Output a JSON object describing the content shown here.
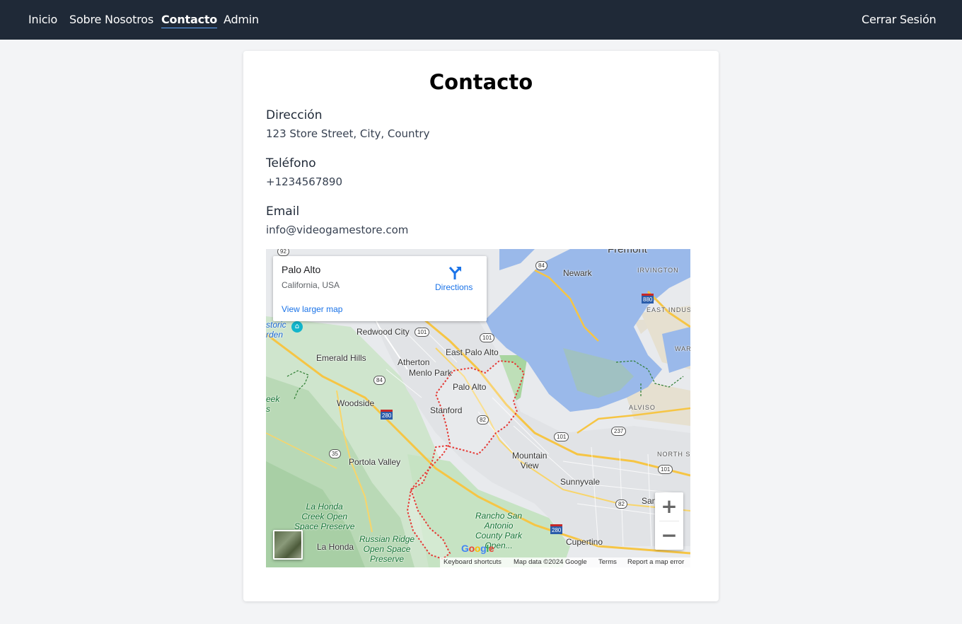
{
  "nav": {
    "links": [
      "Inicio",
      "Sobre Nosotros",
      "Contacto",
      "Admin"
    ],
    "logout": "Cerrar Sesión",
    "active": "Contacto"
  },
  "contact": {
    "title": "Contacto",
    "address_label": "Dirección",
    "address": "123 Store Street, City, Country",
    "phone_label": "Teléfono",
    "phone": "+1234567890",
    "email_label": "Email",
    "email": "info@videogamestore.com"
  },
  "map": {
    "info": {
      "place": "Palo Alto",
      "region": "California, USA",
      "directions": "Directions",
      "larger_map": "View larger map"
    },
    "labels": {
      "fremont": "Fremont",
      "newark": "Newark",
      "irvington": "IRVINGTON",
      "east_indust": "EAST INDUST",
      "historic_garden": "storic\nrden",
      "redwood_city": "Redwood City",
      "east_palo_alto": "East Palo Alto",
      "emerald_hills": "Emerald Hills",
      "atherton": "Atherton",
      "menlo_park": "Menlo Park",
      "palo_alto": "Palo Alto",
      "woodside": "Woodside",
      "stanford": "Stanford",
      "eek": "eek\ns",
      "war": "WAR",
      "alviso": "ALVISO",
      "mountain_view": "Mountain\nView",
      "north_s": "NORTH S",
      "portola_valley": "Portola Valley",
      "sunnyvale": "Sunnyvale",
      "san": "San",
      "la_honda_creek": "La Honda\nCreek Open\nSpace Preserve",
      "rancho_san_antonio": "Rancho San\nAntonio\nCounty Park\nOpen...",
      "russian_ridge": "Russian Ridge\nOpen Space\nPreserve",
      "la_honda": "La Honda",
      "cupertino": "Cupertino"
    },
    "shields": {
      "r92": "92",
      "r84a": "84",
      "r880": "880",
      "r101a": "101",
      "r101b": "101",
      "r84b": "84",
      "r280a": "280",
      "r82a": "82",
      "r237": "237",
      "r101c": "101",
      "r35": "35",
      "r101d": "101",
      "r82b": "82",
      "r280b": "280"
    },
    "zoom_in": "+",
    "zoom_out": "−",
    "google": [
      "G",
      "o",
      "o",
      "g",
      "l",
      "e"
    ],
    "attribution": {
      "shortcuts": "Keyboard shortcuts",
      "data": "Map data ©2024 Google",
      "terms": "Terms",
      "report": "Report a map error"
    }
  },
  "colors": {
    "nav_bg": "#1f2937",
    "page_bg": "#f3f4f6",
    "water": "#9ab9ea",
    "park": "#c6e3c3",
    "boundary": "#e53935",
    "link": "#1a73e8"
  }
}
